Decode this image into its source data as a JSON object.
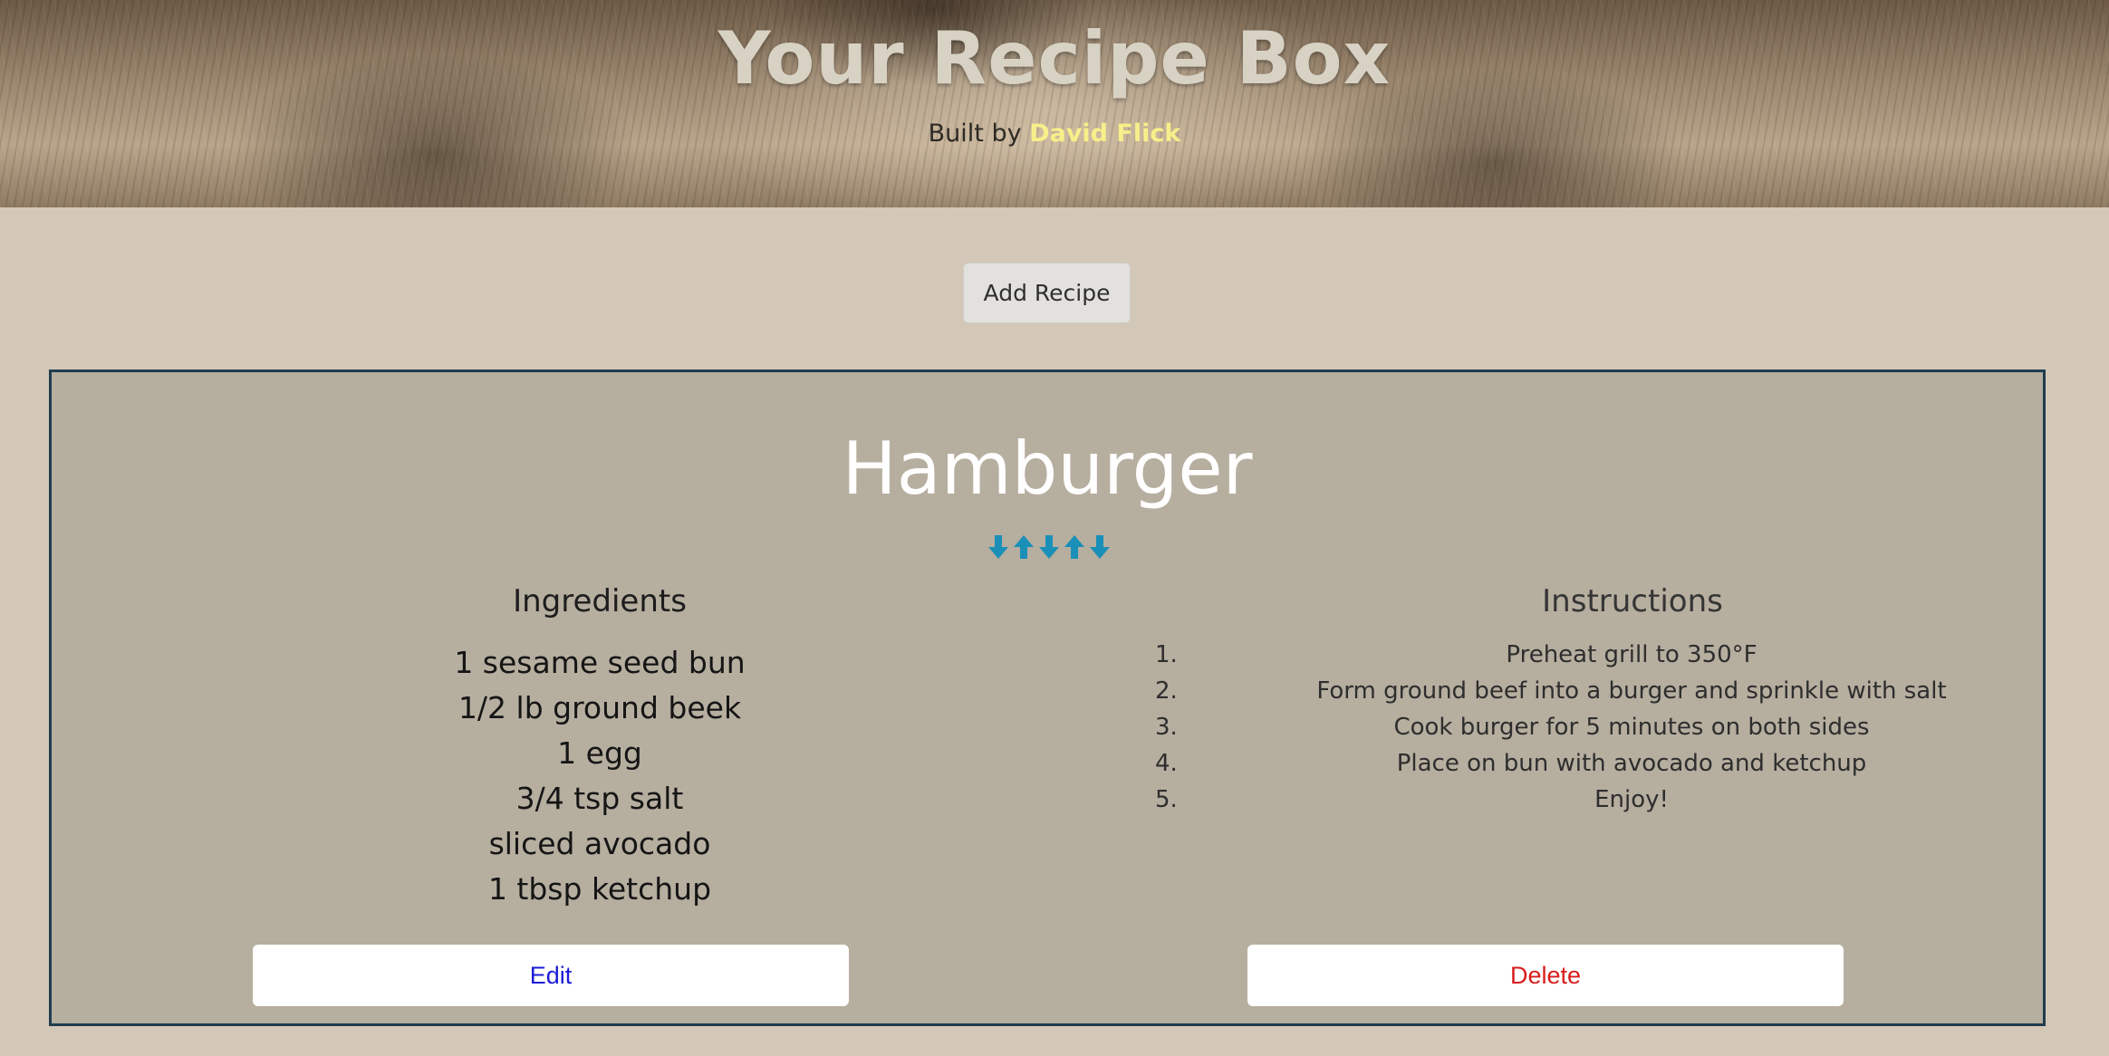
{
  "header": {
    "title": "Your Recipe Box",
    "byline_prefix": "Built by",
    "author": "David Flick"
  },
  "toolbar": {
    "add_label": "Add Recipe"
  },
  "recipe": {
    "name": "Hamburger",
    "reorder_arrows": [
      "arrow-down-icon",
      "arrow-up-icon",
      "arrow-down-icon",
      "arrow-up-icon",
      "arrow-down-icon"
    ],
    "ingredients_heading": "Ingredients",
    "ingredients": [
      "1 sesame seed bun",
      "1/2 lb ground beek",
      "1 egg",
      "3/4 tsp salt",
      "sliced avocado",
      "1 tbsp ketchup"
    ],
    "instructions_heading": "Instructions",
    "instructions": [
      {
        "num": "1.",
        "text": "Preheat grill to 350°F"
      },
      {
        "num": "2.",
        "text": "Form ground beef into a burger and sprinkle with salt"
      },
      {
        "num": "3.",
        "text": "Cook burger for 5 minutes on both sides"
      },
      {
        "num": "4.",
        "text": "Place on bun with avocado and ketchup"
      },
      {
        "num": "5.",
        "text": "Enjoy!"
      }
    ],
    "edit_label": "Edit",
    "delete_label": "Delete"
  },
  "colors": {
    "page_bg": "#d3c7b8",
    "card_bg": "#b6ae9f",
    "card_border": "#1f3d4f",
    "arrow": "#1a90b8",
    "author": "#f6ef8a",
    "edit": "#1c1cd6",
    "delete": "#d81c1c"
  }
}
